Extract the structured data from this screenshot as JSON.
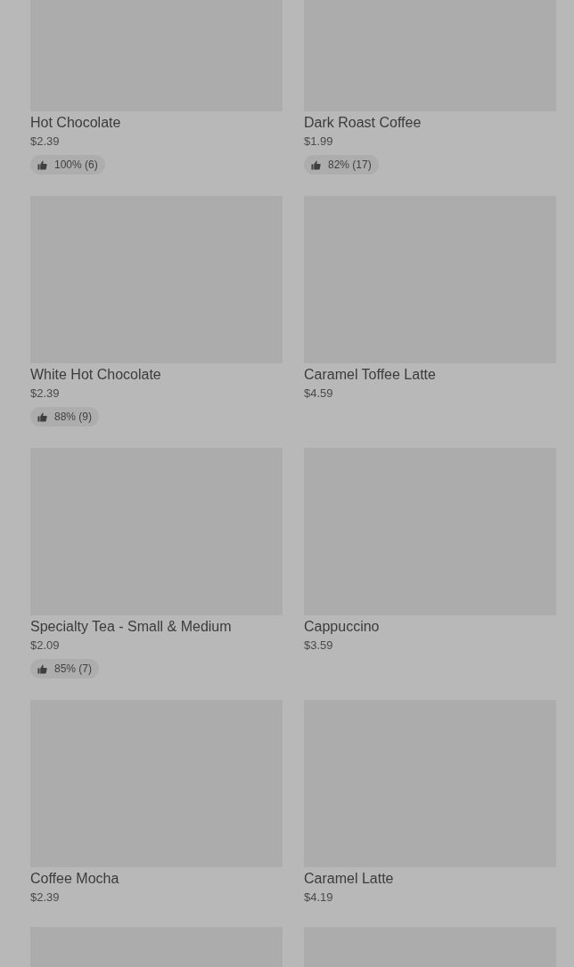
{
  "items": [
    {
      "kind": "product",
      "name": "Hot Chocolate",
      "price": "$2.39",
      "rating": "100% (6)"
    },
    {
      "kind": "product",
      "name": "Dark Roast Coffee",
      "price": "$1.99",
      "rating": "82% (17)"
    },
    {
      "kind": "product",
      "name": "White Hot Chocolate",
      "price": "$2.39",
      "rating": "88% (9)"
    },
    {
      "kind": "product",
      "name": "Caramel Toffee Latte",
      "price": "$4.59"
    },
    {
      "kind": "product",
      "name": "Specialty Tea - Small & Medium",
      "price": "$2.09",
      "rating": "85% (7)"
    },
    {
      "kind": "product",
      "name": "Cappuccino",
      "price": "$3.59"
    },
    {
      "kind": "product",
      "name": "Coffee Mocha",
      "price": "$2.39"
    },
    {
      "kind": "product",
      "name": "Caramel Latte",
      "price": "$4.19"
    },
    {
      "kind": "image_only"
    },
    {
      "kind": "image_only"
    }
  ]
}
